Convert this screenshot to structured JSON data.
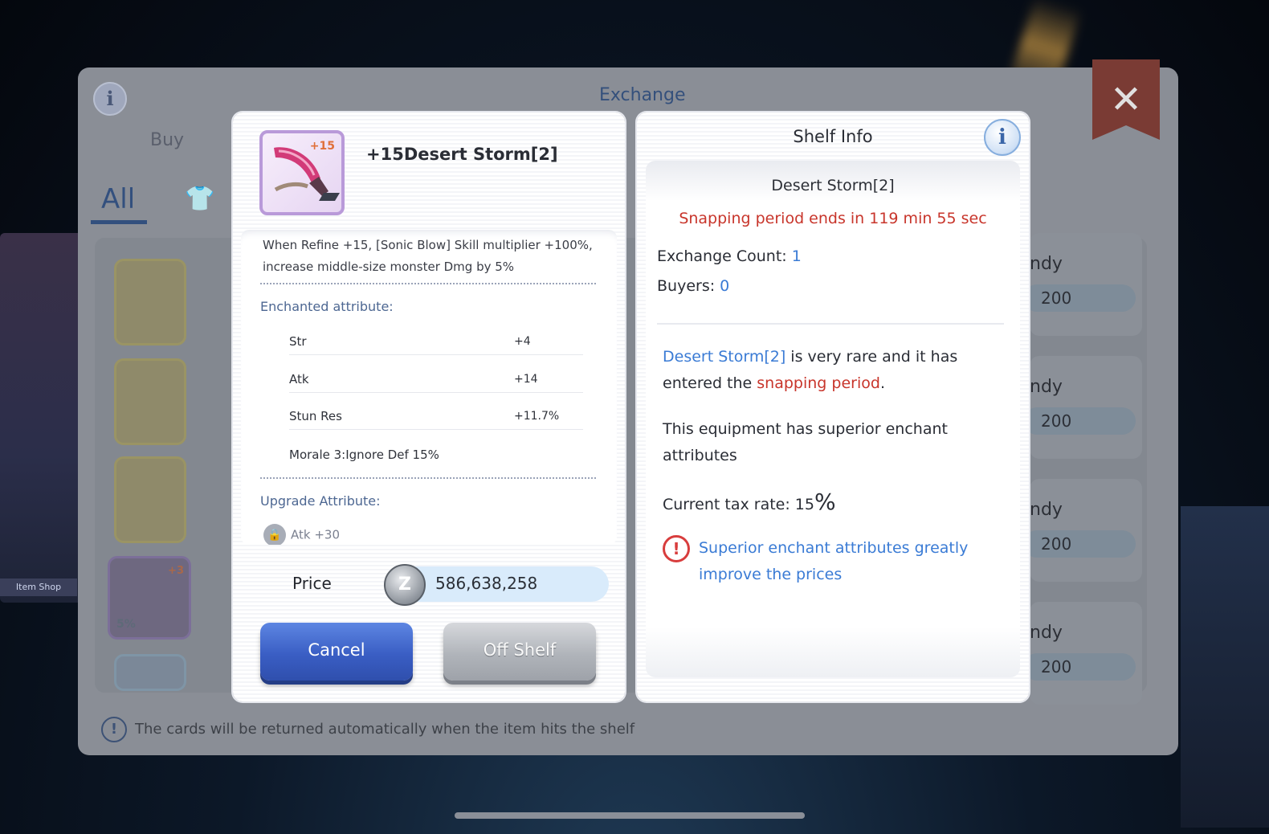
{
  "background": {
    "shop_label": "Item Shop"
  },
  "exchange": {
    "title": "Exchange",
    "tab_buy": "Buy",
    "filter_all": "All",
    "cards": [
      {
        "refine": "",
        "pct": ""
      },
      {
        "refine": "",
        "pct": ""
      },
      {
        "refine": "",
        "pct": ""
      },
      {
        "refine": "+3",
        "pct": "5%"
      }
    ],
    "rows": [
      {
        "name": "ndy",
        "price": "200"
      },
      {
        "name": "ndy",
        "price": "200"
      },
      {
        "name": "ndy",
        "price": "200"
      },
      {
        "name": "ndy",
        "price": "200"
      }
    ],
    "footer_note": "The cards will be returned automatically when the item hits the shelf"
  },
  "item": {
    "refine_badge": "+15",
    "name": "+15Desert Storm[2]",
    "description": "When Refine +15, [Sonic Blow] Skill multiplier +100%, increase middle-size monster Dmg by 5%",
    "enchanted_label": "Enchanted attribute:",
    "attributes": [
      {
        "name": "Str",
        "value": "+4"
      },
      {
        "name": "Atk",
        "value": "+14"
      },
      {
        "name": "Stun Res",
        "value": "+11.7%"
      }
    ],
    "special_attribute": "Morale 3:Ignore Def 15%",
    "upgrade_label": "Upgrade Attribute:",
    "upgrade_value": "Atk +30",
    "price_label": "Price",
    "price_value": "586,638,258",
    "cancel_label": "Cancel",
    "off_shelf_label": "Off Shelf"
  },
  "shelf": {
    "title": "Shelf Info",
    "item_name": "Desert Storm[2]",
    "snapping_text": "Snapping period ends in 119 min 55 sec",
    "exchange_count_label": "Exchange Count:",
    "exchange_count": "1",
    "buyers_label": "Buyers:",
    "buyers": "0",
    "rare_item": "Desert Storm[2]",
    "rare_text_1": " is very rare and it has entered the ",
    "rare_highlight": "snapping period",
    "rare_text_2": ".",
    "superior_text": "This equipment has superior enchant attributes",
    "tax_label": "Current tax rate: 15",
    "tax_pct": "%",
    "note": "Superior enchant attributes greatly improve the prices"
  },
  "colors": {
    "accent_blue": "#3a7bd5",
    "alert_red": "#c8352b",
    "cancel_button": "#3a5ec4",
    "off_shelf_button": "#b0b4ba"
  },
  "icons": [
    "info-icon",
    "close-icon",
    "shirt-icon",
    "zeny-coin-icon",
    "lock-icon",
    "warning-icon",
    "exclamation-icon"
  ]
}
